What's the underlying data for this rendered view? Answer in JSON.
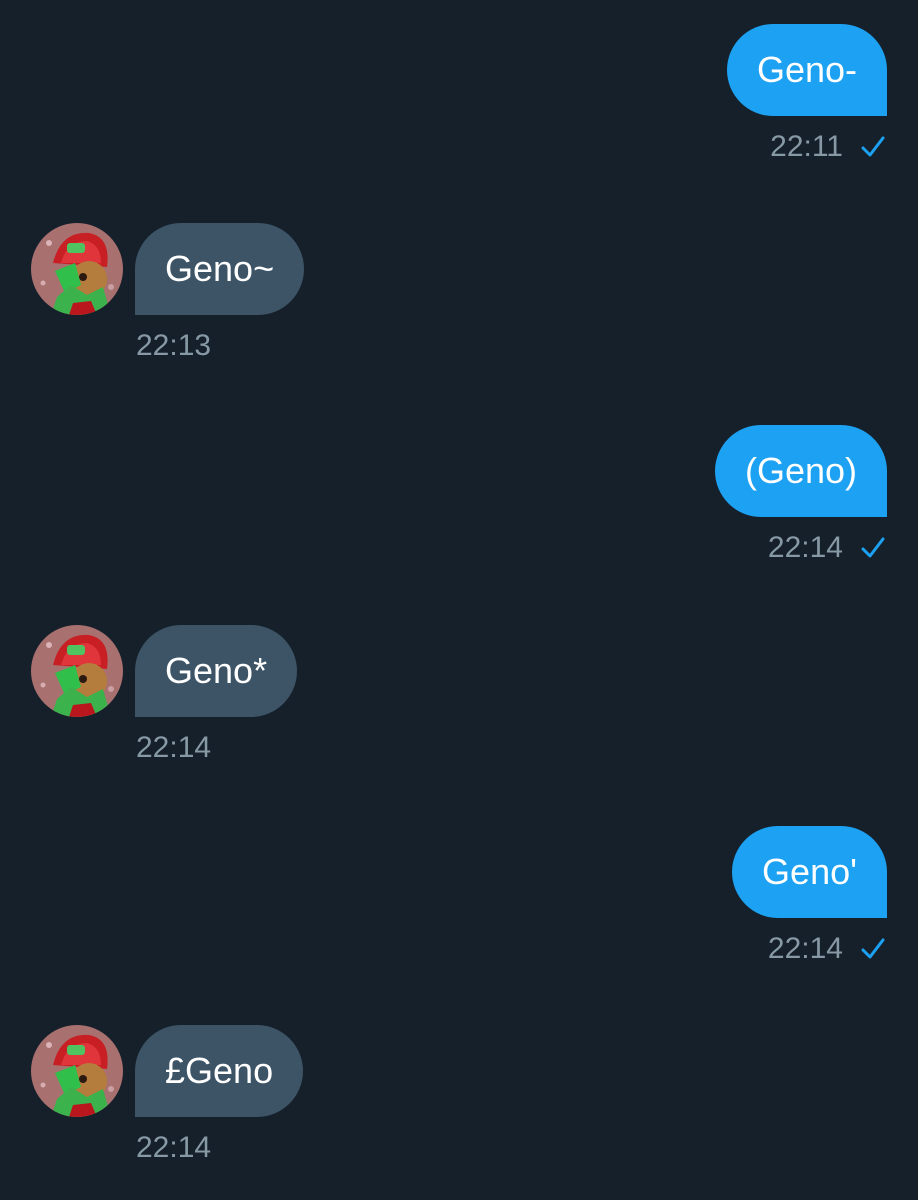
{
  "conversation": {
    "messages": [
      {
        "direction": "sent",
        "text": "Geno-",
        "time": "22:11",
        "status_icon": "checkmark-icon"
      },
      {
        "direction": "received",
        "text": "Geno~",
        "time": "22:13",
        "avatar_icon": "avatar"
      },
      {
        "direction": "sent",
        "text": "(Geno)",
        "time": "22:14",
        "status_icon": "checkmark-icon"
      },
      {
        "direction": "received",
        "text": "Geno*",
        "time": "22:14",
        "avatar_icon": "avatar"
      },
      {
        "direction": "sent",
        "text": "Geno'",
        "time": "22:14",
        "status_icon": "checkmark-icon"
      },
      {
        "direction": "received",
        "text": "£Geno",
        "time": "22:14",
        "avatar_icon": "avatar"
      }
    ]
  },
  "colors": {
    "background": "#15202b",
    "sent_bubble": "#1da1f2",
    "received_bubble": "#3d5466",
    "timestamp": "#8899a6",
    "check": "#1da1f2"
  }
}
